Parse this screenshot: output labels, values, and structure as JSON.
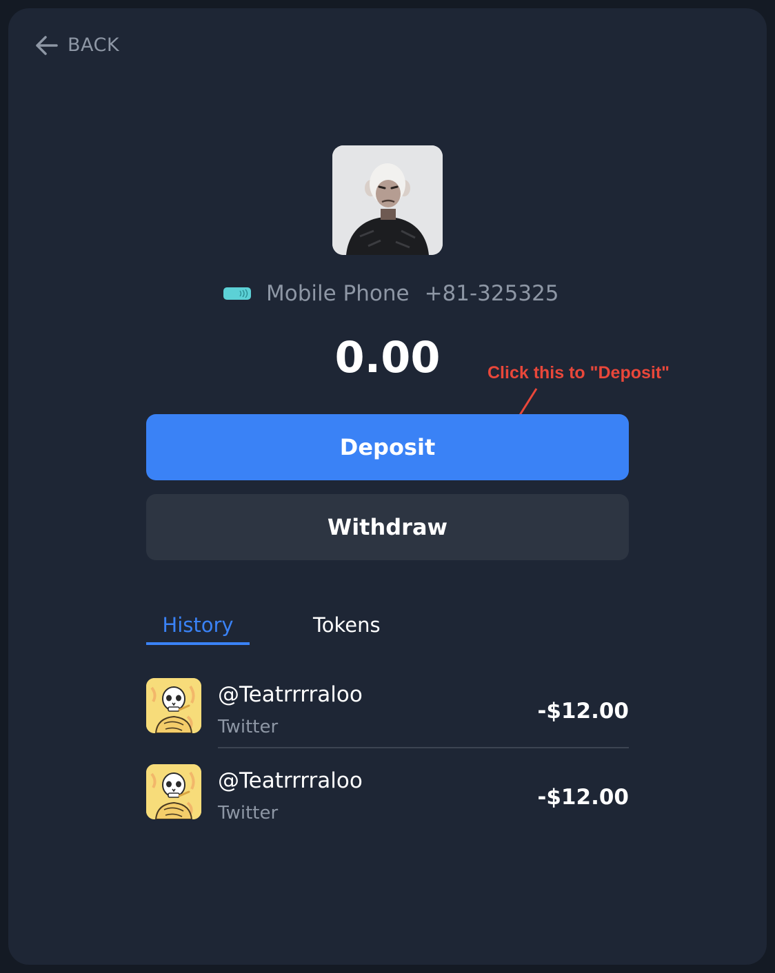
{
  "nav": {
    "back_label": "BACK"
  },
  "profile": {
    "avatar_icon": "ape-avatar-icon",
    "contact_type": "Mobile Phone",
    "phone_number": "+81-325325",
    "phone_icon_color": "#5cd1d6"
  },
  "balance": "0.00",
  "annotation": {
    "text": "Click this to \"Deposit\"",
    "color": "#e9473a"
  },
  "actions": {
    "deposit_label": "Deposit",
    "withdraw_label": "Withdraw",
    "deposit_color": "#3a82f6"
  },
  "tabs": [
    {
      "label": "History",
      "active": true
    },
    {
      "label": "Tokens",
      "active": false
    }
  ],
  "transactions": [
    {
      "handle": "@Teatrrrraloo",
      "source": "Twitter",
      "amount": "-$12.00",
      "avatar_icon": "skull-avatar-icon"
    },
    {
      "handle": "@Teatrrrraloo",
      "source": "Twitter",
      "amount": "-$12.00",
      "avatar_icon": "skull-avatar-icon"
    }
  ]
}
